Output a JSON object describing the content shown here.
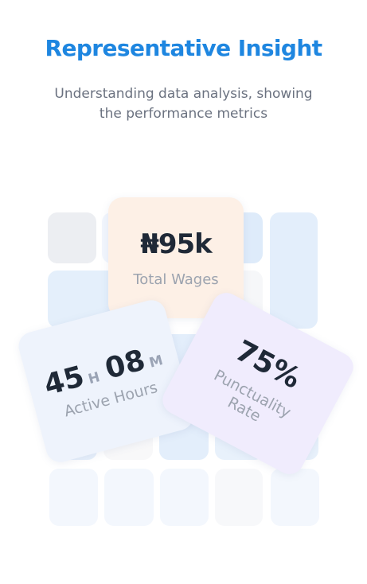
{
  "header": {
    "title": "Representative Insight",
    "subtitle_line1": "Understanding  data analysis, showing",
    "subtitle_line2": "the performance metrics"
  },
  "cards": {
    "wages": {
      "value": "₦95k",
      "label": "Total Wages"
    },
    "hours": {
      "hours": "45",
      "hours_unit": "H",
      "minutes": "08",
      "minutes_unit": "M",
      "label": "Active Hours"
    },
    "punctuality": {
      "value": "75%",
      "label_line1": "Punctuality",
      "label_line2": "Rate"
    }
  },
  "colors": {
    "title": "#1e86e0",
    "wages_card": "#fdf0e6",
    "hours_card": "#eef3fc",
    "punctuality_card": "#f0ecfd"
  }
}
